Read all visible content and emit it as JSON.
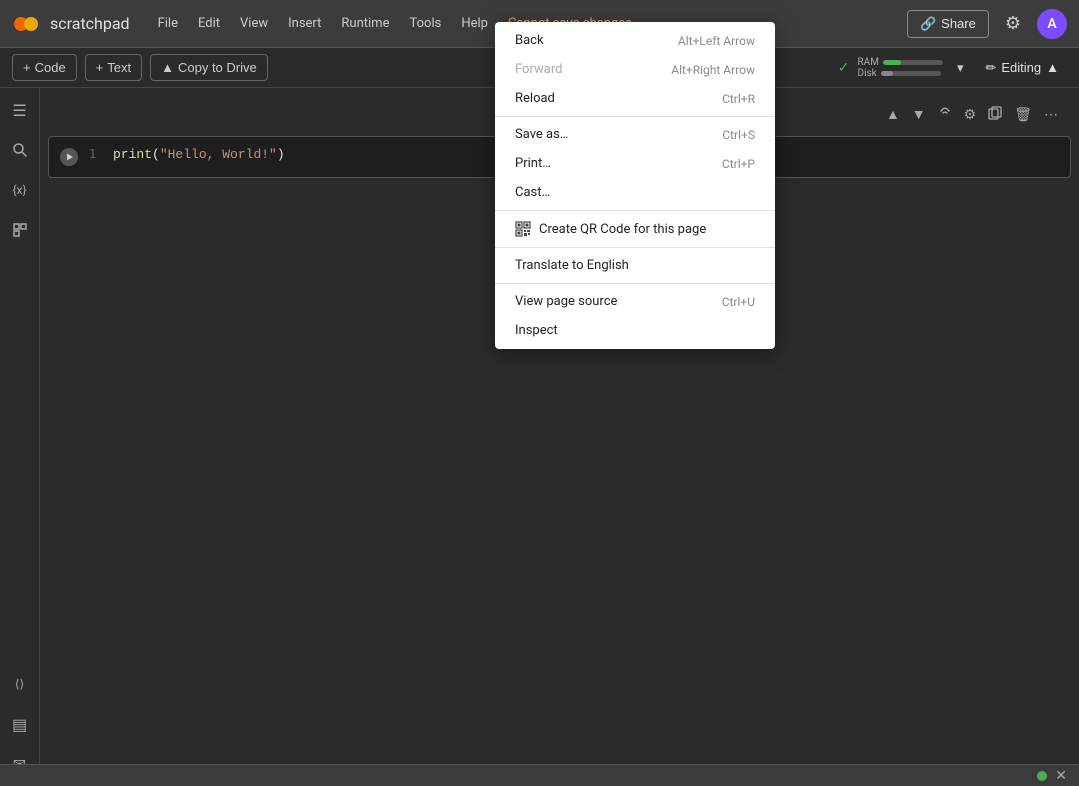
{
  "app": {
    "title": "scratchpad",
    "logo_color": "#FF6D00"
  },
  "menu": {
    "items": [
      "File",
      "Edit",
      "View",
      "Insert",
      "Runtime",
      "Tools",
      "Help"
    ],
    "cannot_save": "Cannot save changes"
  },
  "top_right": {
    "share_label": "Share",
    "link_icon": "🔗",
    "settings_icon": "⚙",
    "avatar_letter": "A",
    "avatar_color": "#7c4dff"
  },
  "toolbar": {
    "code_btn": "+ Code",
    "text_btn": "+ Text",
    "copy_drive_btn": "Copy to Drive",
    "ram_label": "RAM",
    "disk_label": "Disk",
    "ram_pct": 30,
    "disk_pct": 20,
    "editing_label": "Editing",
    "check_color": "#4caf50"
  },
  "cell": {
    "line_number": "1",
    "code_fn": "print",
    "code_open": "(",
    "code_str": "\"Hello, World!\"",
    "code_close": ")"
  },
  "context_menu": {
    "items": [
      {
        "label": "Back",
        "shortcut": "Alt+Left Arrow",
        "disabled": false
      },
      {
        "label": "Forward",
        "shortcut": "Alt+Right Arrow",
        "disabled": true
      },
      {
        "label": "Reload",
        "shortcut": "Ctrl+R",
        "disabled": false
      },
      {
        "divider": true
      },
      {
        "label": "Save as…",
        "shortcut": "Ctrl+S",
        "disabled": false
      },
      {
        "label": "Print…",
        "shortcut": "Ctrl+P",
        "disabled": false
      },
      {
        "label": "Cast…",
        "shortcut": "",
        "disabled": false
      },
      {
        "divider": true
      },
      {
        "label": "Create QR Code for this page",
        "shortcut": "",
        "has_icon": true,
        "disabled": false
      },
      {
        "divider": true
      },
      {
        "label": "Translate to English",
        "shortcut": "",
        "disabled": false
      },
      {
        "divider": true
      },
      {
        "label": "View page source",
        "shortcut": "Ctrl+U",
        "disabled": false
      },
      {
        "label": "Inspect",
        "shortcut": "",
        "disabled": false
      }
    ]
  },
  "sidebar": {
    "icons": [
      "☰",
      "🔍",
      "{x}",
      "◱"
    ]
  },
  "sidebar_bottom": {
    "icons": [
      "⟨⟩",
      "▤",
      "✉"
    ]
  },
  "cell_toolbar": {
    "icons": [
      "▲",
      "▼",
      "🔗",
      "⚙",
      "📋",
      "🗑",
      "⋯"
    ]
  },
  "status": {
    "dot_color": "#4caf50"
  }
}
